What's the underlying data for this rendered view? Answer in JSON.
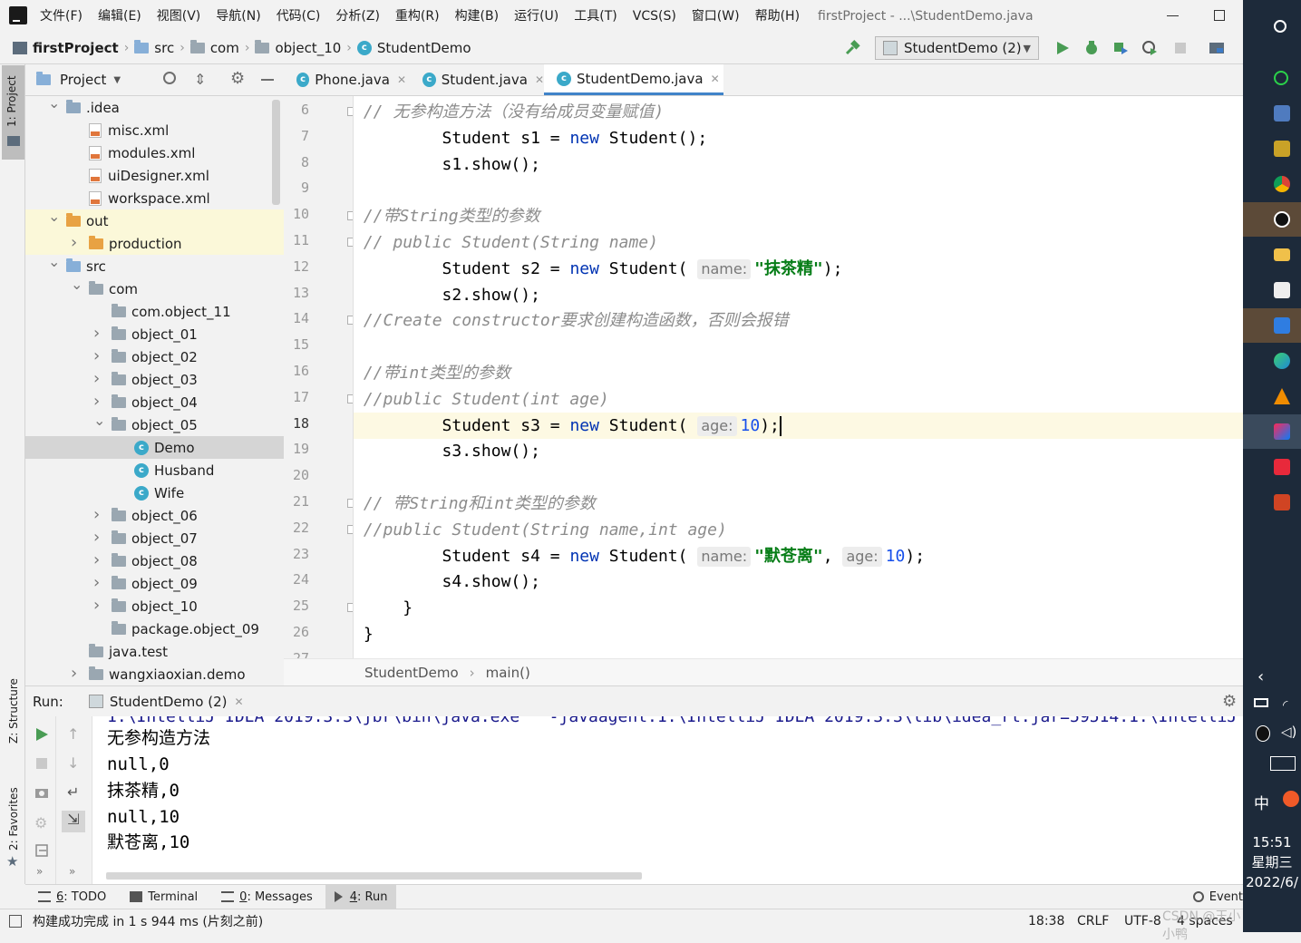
{
  "menubar": {
    "items": [
      "文件(F)",
      "编辑(E)",
      "视图(V)",
      "导航(N)",
      "代码(C)",
      "分析(Z)",
      "重构(R)",
      "构建(B)",
      "运行(U)",
      "工具(T)",
      "VCS(S)",
      "窗口(W)",
      "帮助(H)"
    ],
    "window_title": "firstProject - ...\\StudentDemo.java"
  },
  "navbar": {
    "crumbs": [
      "firstProject",
      "src",
      "com",
      "object_10",
      "StudentDemo"
    ],
    "run_config": "StudentDemo (2)"
  },
  "left_stripe": {
    "project": "1: Project",
    "structure": "Z: Structure",
    "favorites": "2: Favorites"
  },
  "project_panel": {
    "title": "Project",
    "tree": [
      {
        "label": ".idea",
        "depth": 1,
        "icon": "folder",
        "expanded": true
      },
      {
        "label": "misc.xml",
        "depth": 2,
        "icon": "xml"
      },
      {
        "label": "modules.xml",
        "depth": 2,
        "icon": "xml"
      },
      {
        "label": "uiDesigner.xml",
        "depth": 2,
        "icon": "xml"
      },
      {
        "label": "workspace.xml",
        "depth": 2,
        "icon": "xml"
      },
      {
        "label": "out",
        "depth": 1,
        "icon": "folder-orange",
        "expanded": true
      },
      {
        "label": "production",
        "depth": 2,
        "icon": "folder-orange",
        "expanded": false
      },
      {
        "label": "src",
        "depth": 1,
        "icon": "folder-blue",
        "expanded": true
      },
      {
        "label": "com",
        "depth": 2,
        "icon": "package",
        "expanded": true
      },
      {
        "label": "com.object_11",
        "depth": 3,
        "icon": "package"
      },
      {
        "label": "object_01",
        "depth": 3,
        "icon": "package",
        "expanded": false
      },
      {
        "label": "object_02",
        "depth": 3,
        "icon": "package",
        "expanded": false
      },
      {
        "label": "object_03",
        "depth": 3,
        "icon": "package",
        "expanded": false
      },
      {
        "label": "object_04",
        "depth": 3,
        "icon": "package",
        "expanded": false
      },
      {
        "label": "object_05",
        "depth": 3,
        "icon": "package",
        "expanded": true
      },
      {
        "label": "Demo",
        "depth": 4,
        "icon": "class"
      },
      {
        "label": "Husband",
        "depth": 4,
        "icon": "class"
      },
      {
        "label": "Wife",
        "depth": 4,
        "icon": "class"
      },
      {
        "label": "object_06",
        "depth": 3,
        "icon": "package",
        "expanded": false
      },
      {
        "label": "object_07",
        "depth": 3,
        "icon": "package",
        "expanded": false
      },
      {
        "label": "object_08",
        "depth": 3,
        "icon": "package",
        "expanded": false
      },
      {
        "label": "object_09",
        "depth": 3,
        "icon": "package",
        "expanded": false
      },
      {
        "label": "object_10",
        "depth": 3,
        "icon": "package",
        "expanded": false
      },
      {
        "label": "package.object_09",
        "depth": 3,
        "icon": "package"
      },
      {
        "label": "java.test",
        "depth": 2,
        "icon": "package"
      },
      {
        "label": "wangxiaoxian.demo",
        "depth": 2,
        "icon": "package",
        "expanded": false
      }
    ]
  },
  "editor_tabs": [
    {
      "label": "Phone.java",
      "active": false
    },
    {
      "label": "Student.java",
      "active": false
    },
    {
      "label": "StudentDemo.java",
      "active": true
    }
  ],
  "editor": {
    "line_numbers": [
      "6",
      "7",
      "8",
      "9",
      "10",
      "11",
      "12",
      "13",
      "14",
      "15",
      "16",
      "17",
      "18",
      "19",
      "20",
      "21",
      "22",
      "23",
      "24",
      "25",
      "26",
      "27"
    ],
    "current_line": "18",
    "lines": [
      {
        "ln": "6",
        "comment": "// 无参构造方法（没有给成员变量赋值)"
      },
      {
        "ln": "7",
        "indent": "        ",
        "t1": "Student s1 = ",
        "kw": "new",
        "t2": " Student();"
      },
      {
        "ln": "8",
        "indent": "        ",
        "t1": "s1.show();"
      },
      {
        "ln": "9"
      },
      {
        "ln": "10",
        "comment": "//带String类型的参数"
      },
      {
        "ln": "11",
        "comment": "// public Student(String name)"
      },
      {
        "ln": "12",
        "indent": "        ",
        "t1": "Student s2 = ",
        "kw": "new",
        "t2": " Student( ",
        "hint": "name:",
        "str": "\"抹茶精\"",
        "t3": ");"
      },
      {
        "ln": "13",
        "indent": "        ",
        "t1": "s2.show();"
      },
      {
        "ln": "14",
        "comment": "//Create constructor要求创建构造函数，否则会报错"
      },
      {
        "ln": "15"
      },
      {
        "ln": "16",
        "comment": "//带int类型的参数"
      },
      {
        "ln": "17",
        "comment": "//public Student(int age)"
      },
      {
        "ln": "18",
        "indent": "        ",
        "t1": "Student s3 = ",
        "kw": "new",
        "t2": " Student( ",
        "hint": "age:",
        "num": "10",
        "t3": ");"
      },
      {
        "ln": "19",
        "indent": "        ",
        "t1": "s3.show();"
      },
      {
        "ln": "20"
      },
      {
        "ln": "21",
        "comment": "// 带String和int类型的参数"
      },
      {
        "ln": "22",
        "comment": "//public Student(String name,int age)"
      },
      {
        "ln": "23",
        "indent": "        ",
        "t1": "Student s4 = ",
        "kw": "new",
        "t2": " Student( ",
        "hint": "name:",
        "str": "\"默苍离\"",
        "t2b": ", ",
        "hint2": "age:",
        "num": "10",
        "t3": ");"
      },
      {
        "ln": "24",
        "indent": "        ",
        "t1": "s4.show();"
      },
      {
        "ln": "25",
        "indent": "    ",
        "t1": "}"
      },
      {
        "ln": "26",
        "t1": "}"
      }
    ],
    "breadcrumb": [
      "StudentDemo",
      "main()"
    ]
  },
  "run_panel": {
    "label": "Run:",
    "tab": "StudentDemo (2)",
    "cut_line": "1.\\IntelliJ IDEA 2019.3.3\\jbr\\bin\\java.exe\"  -javaagent:1:\\IntelliJ IDEA 2019.3.3\\lib\\idea_rt.jar=59514:1:\\IntelliJ",
    "output": [
      "无参构造方法",
      "null,0",
      "抹茶精,0",
      "null,10",
      "默苍离,10"
    ]
  },
  "bottom_tools": [
    {
      "num": "6",
      "label": ": TODO"
    },
    {
      "num": "",
      "label": "Terminal"
    },
    {
      "num": "0",
      "label": ": Messages"
    },
    {
      "num": "4",
      "label": ": Run"
    }
  ],
  "event_log": "Event",
  "statusbar": {
    "message": "构建成功完成 in 1 s 944 ms (片刻之前)",
    "position": "18:38",
    "line_sep": "CRLF",
    "encoding": "UTF-8",
    "indent": "4 spaces",
    "watermark": "CSDN @王小小鸭"
  },
  "taskbar": {
    "ime": "中",
    "time": "15:51",
    "weekday": "星期三",
    "date": "2022/6/"
  },
  "colors": {
    "keyword": "#0033b3",
    "string": "#067d17",
    "number": "#1750eb",
    "comment": "#8c8c8c",
    "current_line": "#fdf9e3",
    "accent": "#4083c9"
  }
}
